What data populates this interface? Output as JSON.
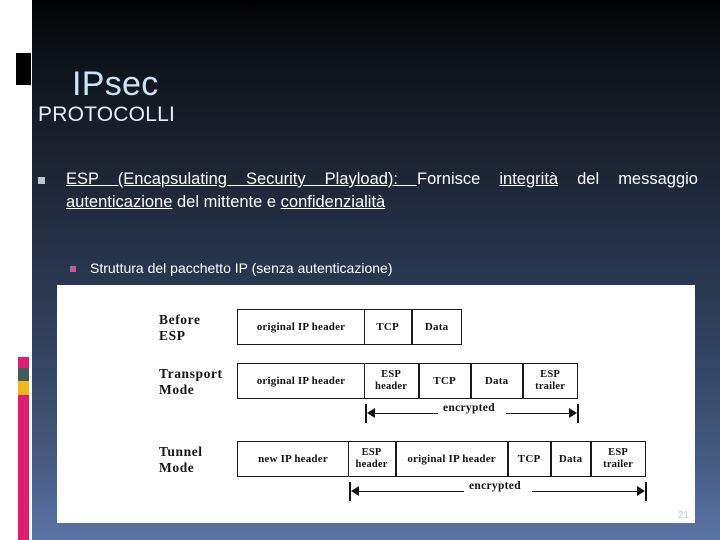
{
  "slide": {
    "title": "IPsec",
    "subtitle": "PROTOCOLLI",
    "slide_number": "21",
    "colors": {
      "title": "#c8e6f7",
      "background_top": "#000000",
      "background_bottom": "#5a73a5",
      "accent_pink": "#e31b6d",
      "accent_yellow": "#f7b618",
      "accent_slate": "#3f5c59",
      "marker_level1": "#b9c6d8",
      "marker_level2": "#c05f8e",
      "panel": "#ffffff"
    }
  },
  "bullets": {
    "level1": {
      "marker": "square-bullet-icon",
      "runs": [
        {
          "text": "ESP ",
          "underline": true
        },
        {
          "text": "(Encapsulating ",
          "underline": true
        },
        {
          "text": "Security ",
          "underline": true
        },
        {
          "text": "Playload): ",
          "underline": true
        },
        {
          "text": "Fornisce ",
          "underline": false
        },
        {
          "text": "integrità",
          "underline": true
        },
        {
          "text": " del messaggio ",
          "underline": false
        },
        {
          "text": "autenticazione",
          "underline": true
        },
        {
          "text": " del mittente e ",
          "underline": false
        },
        {
          "text": "confidenzialità",
          "underline": true
        }
      ],
      "plain_text": "ESP (Encapsulating Security Playload): Fornisce integrità del messaggio autenticazione del mittente e confidenzialità"
    },
    "level2": {
      "marker": "square-bullet-icon",
      "text": "Struttura del pacchetto IP (senza autenticazione)"
    }
  },
  "diagram": {
    "title": "ESP packet structure",
    "rows": [
      {
        "label": "Before\nESP",
        "label_lines": [
          "Before",
          "ESP"
        ],
        "fields": [
          {
            "text": "original IP header",
            "lines": [
              "original IP header"
            ]
          },
          {
            "text": "TCP",
            "lines": [
              "TCP"
            ]
          },
          {
            "text": "Data",
            "lines": [
              "Data"
            ]
          }
        ],
        "encrypted_span": null
      },
      {
        "label": "Transport\nMode",
        "label_lines": [
          "Transport",
          "Mode"
        ],
        "fields": [
          {
            "text": "original IP header",
            "lines": [
              "original IP header"
            ]
          },
          {
            "text": "ESP header",
            "lines": [
              "ESP",
              "header"
            ]
          },
          {
            "text": "TCP",
            "lines": [
              "TCP"
            ]
          },
          {
            "text": "Data",
            "lines": [
              "Data"
            ]
          },
          {
            "text": "ESP trailer",
            "lines": [
              "ESP",
              "trailer"
            ]
          }
        ],
        "encrypted_span": {
          "label": "encrypted"
        }
      },
      {
        "label": "Tunnel\nMode",
        "label_lines": [
          "Tunnel",
          "Mode"
        ],
        "fields": [
          {
            "text": "new IP header",
            "lines": [
              "new IP header"
            ]
          },
          {
            "text": "ESP header",
            "lines": [
              "ESP",
              "header"
            ]
          },
          {
            "text": "original IP header",
            "lines": [
              "original IP header"
            ]
          },
          {
            "text": "TCP",
            "lines": [
              "TCP"
            ]
          },
          {
            "text": "Data",
            "lines": [
              "Data"
            ]
          },
          {
            "text": "ESP trailer",
            "lines": [
              "ESP",
              "trailer"
            ]
          }
        ],
        "encrypted_span": {
          "label": "encrypted"
        }
      }
    ]
  }
}
